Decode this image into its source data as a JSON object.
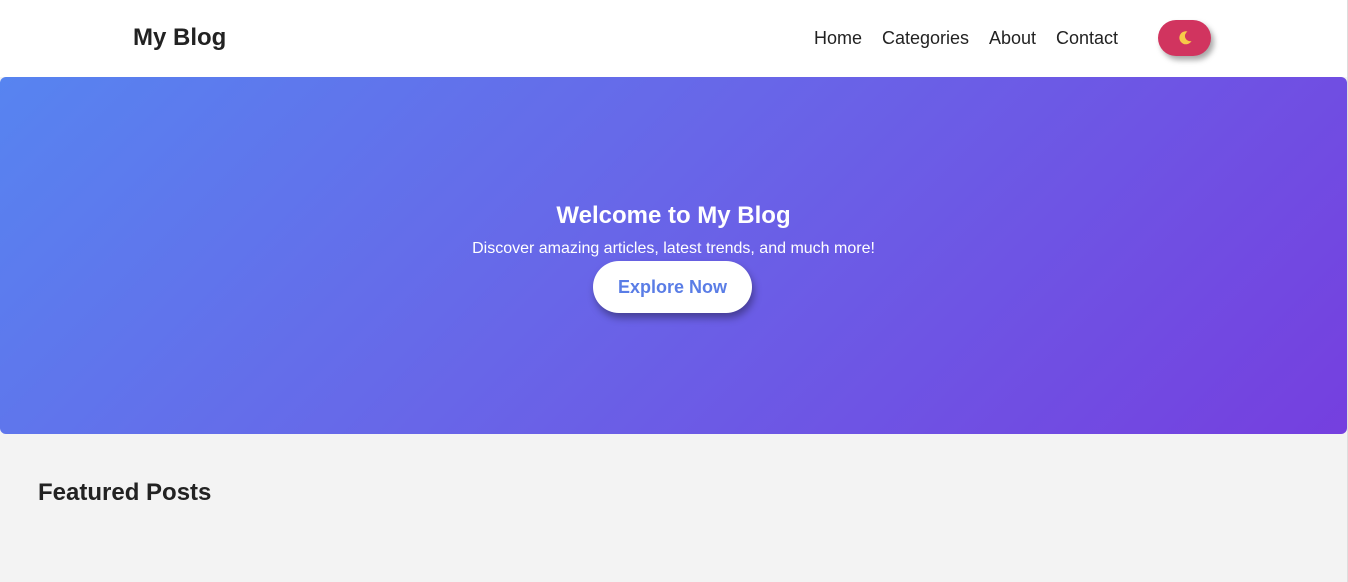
{
  "header": {
    "logo": "My Blog",
    "nav": [
      {
        "label": "Home"
      },
      {
        "label": "Categories"
      },
      {
        "label": "About"
      },
      {
        "label": "Contact"
      }
    ],
    "theme_toggle_icon": "moon-icon"
  },
  "hero": {
    "title": "Welcome to My Blog",
    "subtitle": "Discover amazing articles, latest trends, and much more!",
    "button_label": "Explore Now"
  },
  "featured": {
    "title": "Featured Posts"
  },
  "colors": {
    "toggle": "#d1345f",
    "gradient_start": "#5784f0",
    "gradient_end": "#753fdf",
    "button_text": "#5a7de6"
  }
}
